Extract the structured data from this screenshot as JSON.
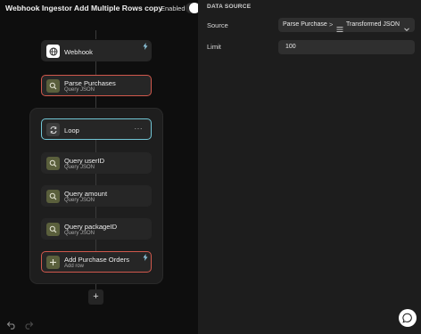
{
  "app": {
    "title": "Webhook Ingestor Add Multiple Rows copy",
    "enabled_label": "Enabled",
    "enabled": true
  },
  "workflow": {
    "nodes": [
      {
        "title": "Webhook",
        "subtitle": "",
        "icon": "globe-icon",
        "badge": "lightning-icon",
        "state": "normal"
      },
      {
        "title": "Parse Purchases",
        "subtitle": "Query JSON",
        "icon": "search-icon",
        "state": "error"
      },
      {
        "title": "Loop",
        "subtitle": "",
        "icon": "loop-icon",
        "menu": "···",
        "state": "selected"
      },
      {
        "title": "Query userID",
        "subtitle": "Query JSON",
        "icon": "search-icon",
        "state": "normal"
      },
      {
        "title": "Query amount",
        "subtitle": "Query JSON",
        "icon": "search-icon",
        "state": "normal"
      },
      {
        "title": "Query packageID",
        "subtitle": "Query JSON",
        "icon": "search-icon",
        "state": "normal"
      },
      {
        "title": "Add Purchase Orders",
        "subtitle": "Add row",
        "icon": "plus-icon",
        "badge": "lightning-icon",
        "state": "error"
      }
    ],
    "add_node_label": "+"
  },
  "panel": {
    "section_title": "DATA SOURCE",
    "source_label": "Source",
    "source_value_part1": "Parse Purchases",
    "source_separator": ">",
    "source_value_part2": "Transformed JSON",
    "limit_label": "Limit",
    "limit_value": "100"
  },
  "colors": {
    "canvas_bg": "#0e0e0e",
    "node_bg": "#262626",
    "error_border": "#d0584c",
    "selected_border": "#72c6d6",
    "panel_bg": "#1d1d1d",
    "input_bg": "#2f2f2f"
  }
}
